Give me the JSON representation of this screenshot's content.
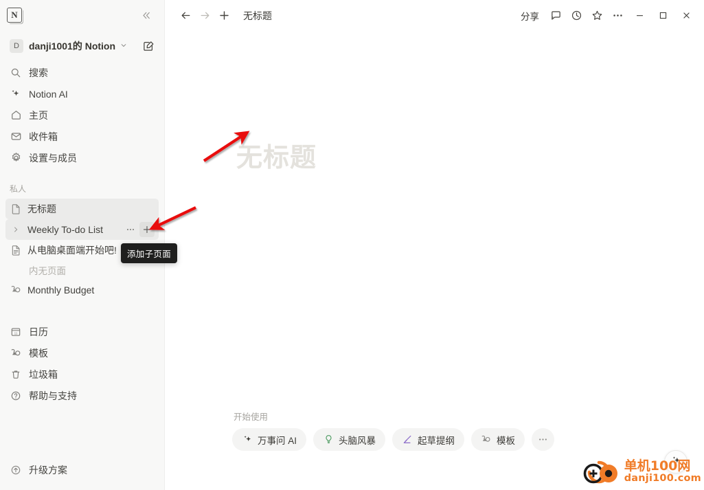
{
  "window": {
    "app_name": "Notion",
    "logo_letter": "N"
  },
  "sidebar": {
    "collapse_icon": "chevrons-left-icon",
    "workspace": {
      "avatar_letter": "D",
      "name": "danji1001的 Notion",
      "chevron": "chevron-down-icon",
      "compose_icon": "compose-icon"
    },
    "nav_items": [
      {
        "icon": "search-icon",
        "label": "搜索"
      },
      {
        "icon": "sparkle-icon",
        "label": "Notion AI"
      },
      {
        "icon": "home-icon",
        "label": "主页"
      },
      {
        "icon": "inbox-icon",
        "label": "收件箱"
      },
      {
        "icon": "gear-icon",
        "label": "设置与成员"
      }
    ],
    "private_section": {
      "label": "私人",
      "pages": [
        {
          "icon": "page-icon",
          "label": "无标题",
          "selected": true
        },
        {
          "icon": "chevron-right-icon",
          "label": "Weekly To-do List",
          "hovered": true,
          "has_actions": true
        },
        {
          "icon": "page-lines-icon",
          "label": "从电脑桌面端开始吧!"
        }
      ],
      "empty_children_label": "内无页面",
      "database_page": {
        "icon": "template-icon",
        "label": "Monthly Budget"
      },
      "more_label": "···",
      "add_label": "+"
    },
    "bottom_items": [
      {
        "icon": "calendar-icon",
        "label": "日历",
        "badge": "11"
      },
      {
        "icon": "template-icon",
        "label": "模板"
      },
      {
        "icon": "trash-icon",
        "label": "垃圾箱"
      },
      {
        "icon": "help-icon",
        "label": "帮助与支持"
      }
    ],
    "upgrade_item": {
      "icon": "upgrade-icon",
      "label": "升级方案"
    },
    "tooltip": "添加子页面"
  },
  "topbar": {
    "back_icon": "arrow-left-icon",
    "forward_icon": "arrow-right-icon",
    "new_icon": "plus-icon",
    "breadcrumb_title": "无标题",
    "share_label": "分享",
    "comment_icon": "comment-icon",
    "history_icon": "clock-icon",
    "favorite_icon": "star-icon",
    "more_icon": "ellipsis-icon",
    "minimize_icon": "minimize-icon",
    "maximize_icon": "maximize-icon",
    "close_icon": "close-icon"
  },
  "document": {
    "title_placeholder": "无标题",
    "getting_started_label": "开始使用",
    "action_pills": [
      {
        "icon": "sparkle-icon",
        "label": "万事问 AI",
        "color": "#37352f"
      },
      {
        "icon": "lightbulb-icon",
        "label": "头脑风暴",
        "color": "#4f9c63"
      },
      {
        "icon": "pen-icon",
        "label": "起草提纲",
        "color": "#8b6cc9"
      },
      {
        "icon": "template-icon",
        "label": "模板",
        "color": "#8a8986"
      }
    ],
    "more_pill": "···",
    "ai_fab_icon": "sparkle-icon"
  },
  "watermark": {
    "main": "单机100网",
    "sub": "danji100.com",
    "color": "#f07c28"
  },
  "annotations": {
    "arrow_color": "#e8080c",
    "arrows": [
      {
        "name": "arrow-to-page-title"
      },
      {
        "name": "arrow-to-add-subpage"
      }
    ]
  }
}
